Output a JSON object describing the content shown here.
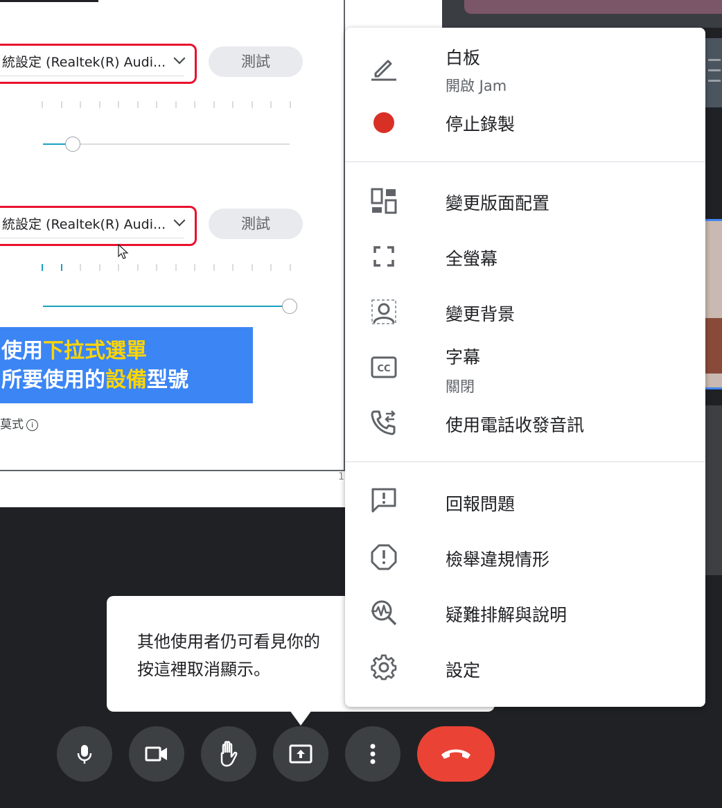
{
  "shared_screen": {
    "device_select_1": "統設定 (Realtek(R) Audi...",
    "test_button_1": "測試",
    "device_select_2": "統設定 (Realtek(R) Audi...",
    "test_button_2": "測試",
    "volume_level_1": 0.12,
    "volume_level_2": 1.0,
    "banner": {
      "line1_a": "使用",
      "line1_b": "下拉式選單",
      "line2_a": "所要使用的",
      "line2_b": "設備",
      "line2_c": "型號"
    },
    "mode_label": "莫式",
    "page_number": "1"
  },
  "menu": {
    "items": [
      {
        "icon": "pencil-icon",
        "label": "白板",
        "sub": "開啟 Jam"
      },
      {
        "icon": "record-dot-icon",
        "label": "停止錄製"
      },
      {
        "icon": "layout-icon",
        "label": "變更版面配置"
      },
      {
        "icon": "fullscreen-icon",
        "label": "全螢幕"
      },
      {
        "icon": "background-icon",
        "label": "變更背景"
      },
      {
        "icon": "captions-icon",
        "label": "字幕",
        "sub": "關閉"
      },
      {
        "icon": "phone-audio-icon",
        "label": "使用電話收發音訊"
      },
      {
        "icon": "feedback-icon",
        "label": "回報問題"
      },
      {
        "icon": "report-abuse-icon",
        "label": "檢舉違規情形"
      },
      {
        "icon": "troubleshoot-icon",
        "label": "疑難排解與說明"
      },
      {
        "icon": "gear-icon",
        "label": "設定"
      }
    ]
  },
  "tooltip": {
    "line1": "其他使用者仍可看見你的",
    "line2": "按這裡取消顯示。"
  },
  "colors": {
    "background": "#202124",
    "record_red": "#d93025",
    "hangup_red": "#ea4335",
    "highlight_yellow": "#ffd500",
    "banner_blue": "#3b85f5"
  }
}
